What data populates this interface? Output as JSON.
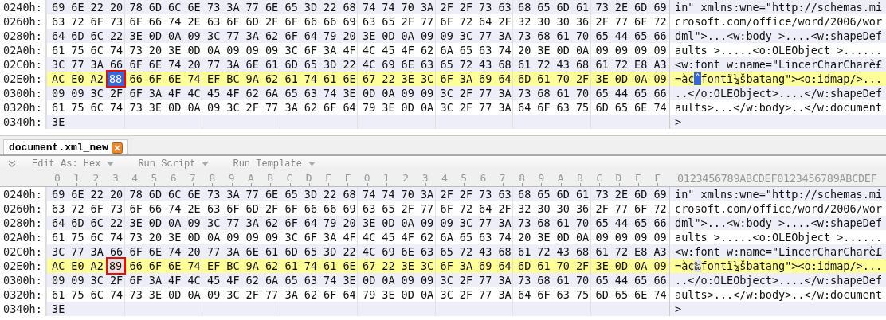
{
  "panes": [
    {
      "rows": [
        {
          "address": "0240h:",
          "hex": "69 6E 22 20 78 6D 6C 6E 73 3A 77 6E 65 3D 22 68 74 74 70 3A 2F 2F 73 63 68 65 6D 61 73 2E 6D 69",
          "text": "in\" xmlns:wne=\"http://schemas.mi",
          "highlighted": false
        },
        {
          "address": "0260h:",
          "hex": "63 72 6F 73 6F 66 74 2E 63 6F 6D 2F 6F 66 66 69 63 65 2F 77 6F 72 64 2F 32 30 30 36 2F 77 6F 72",
          "text": "crosoft.com/office/word/2006/wor",
          "highlighted": false
        },
        {
          "address": "0280h:",
          "hex": "64 6D 6C 22 3E 0D 0A 09 3C 77 3A 62 6F 64 79 20 3E 0D 0A 09 09 3C 77 3A 73 68 61 70 65 44 65 66",
          "text": "dml\">...<w:body >....<w:shapeDef",
          "highlighted": false
        },
        {
          "address": "02A0h:",
          "hex": "61 75 6C 74 73 20 3E 0D 0A 09 09 09 3C 6F 3A 4F 4C 45 4F 62 6A 65 63 74 20 3E 0D 0A 09 09 09 09",
          "text": "aults >.....<o:OLEObject >......",
          "highlighted": false
        },
        {
          "address": "02C0h:",
          "hex": "3C 77 3A 66 6F 6E 74 20 77 3A 6E 61 6D 65 3D 22 4C 69 6E 63 65 72 43 68 61 72 43 68 61 72 E8 A3",
          "text": "<w:font w:name=\"LincerCharCharè£",
          "highlighted": false
        },
        {
          "address": "02E0h:",
          "hex": "AC E0 A2",
          "cursor": {
            "hex": "88",
            "char": "ˆ",
            "selected": true,
            "annotated": true
          },
          "hex_after": "66 6F 6E 74 EF BC 9A 62 61 74 61 6E 67 22 3E 3C 6F 3A 69 64 6D 61 70 2F 3E 0D 0A 09",
          "text": "¬à¢",
          "text_after": "fontï¼šbatang\"><o:idmap/>...",
          "highlighted": true
        },
        {
          "address": "0300h:",
          "hex": "09 09 3C 2F 6F 3A 4F 4C 45 4F 62 6A 65 63 74 3E 0D 0A 09 09 3C 2F 77 3A 73 68 61 70 65 44 65 66",
          "text": "..</o:OLEObject>....</w:shapeDef",
          "highlighted": false
        },
        {
          "address": "0320h:",
          "hex": "61 75 6C 74 73 3E 0D 0A 09 3C 2F 77 3A 62 6F 64 79 3E 0D 0A 3C 2F 77 3A 64 6F 63 75 6D 65 6E 74",
          "text": "aults>...</w:body>..</w:document",
          "highlighted": false
        },
        {
          "address": "0340h:",
          "hex": "3E",
          "text": ">",
          "highlighted": false
        }
      ]
    },
    {
      "tab": {
        "label": "document.xml_new",
        "selected": true
      },
      "toolbar": [
        {
          "label": "Edit As: Hex"
        },
        {
          "label": "Run Script"
        },
        {
          "label": "Run Template"
        }
      ],
      "column_header": {
        "hex_digits": "0 1 2 3 4 5 6 7 8 9 A B C D E F 0 1 2 3 4 5 6 7 8 9 A B C D E F",
        "text_digits": "0123456789ABCDEF0123456789ABCDEF"
      },
      "rows": [
        {
          "address": "0240h:",
          "hex": "69 6E 22 20 78 6D 6C 6E 73 3A 77 6E 65 3D 22 68 74 74 70 3A 2F 2F 73 63 68 65 6D 61 73 2E 6D 69",
          "text": "in\" xmlns:wne=\"http://schemas.mi",
          "highlighted": false
        },
        {
          "address": "0260h:",
          "hex": "63 72 6F 73 6F 66 74 2E 63 6F 6D 2F 6F 66 66 69 63 65 2F 77 6F 72 64 2F 32 30 30 36 2F 77 6F 72",
          "text": "crosoft.com/office/word/2006/wor",
          "highlighted": false
        },
        {
          "address": "0280h:",
          "hex": "64 6D 6C 22 3E 0D 0A 09 3C 77 3A 62 6F 64 79 20 3E 0D 0A 09 09 3C 77 3A 73 68 61 70 65 44 65 66",
          "text": "dml\">...<w:body >....<w:shapeDef",
          "highlighted": false
        },
        {
          "address": "02A0h:",
          "hex": "61 75 6C 74 73 20 3E 0D 0A 09 09 09 3C 6F 3A 4F 4C 45 4F 62 6A 65 63 74 20 3E 0D 0A 09 09 09 09",
          "text": "aults >.....<o:OLEObject >......",
          "highlighted": false
        },
        {
          "address": "02C0h:",
          "hex": "3C 77 3A 66 6F 6E 74 20 77 3A 6E 61 6D 65 3D 22 4C 69 6E 63 65 72 43 68 61 72 43 68 61 72 E8 A3",
          "text": "<w:font w:name=\"LincerCharCharè£",
          "highlighted": false
        },
        {
          "address": "02E0h:",
          "hex": "AC E0 A2",
          "cursor": {
            "hex": "89",
            "char": "‰",
            "selected": false,
            "annotated": true
          },
          "hex_after": "66 6F 6E 74 EF BC 9A 62 61 74 61 6E 67 22 3E 3C 6F 3A 69 64 6D 61 70 2F 3E 0D 0A 09",
          "text": "¬à¢",
          "text_after": "fontï¼šbatang\"><o:idmap/>...",
          "highlighted": true
        },
        {
          "address": "0300h:",
          "hex": "09 09 3C 2F 6F 3A 4F 4C 45 4F 62 6A 65 63 74 3E 0D 0A 09 09 3C 2F 77 3A 73 68 61 70 65 44 65 66",
          "text": "..</o:OLEObject>....</w:shapeDef",
          "highlighted": false
        },
        {
          "address": "0320h:",
          "hex": "61 75 6C 74 73 3E 0D 0A 09 3C 2F 77 3A 62 6F 64 79 3E 0D 0A 3C 2F 77 3A 64 6F 63 75 6D 65 6E 74",
          "text": "aults>...</w:body>..</w:document",
          "highlighted": false
        },
        {
          "address": "0340h:",
          "hex": "3E",
          "text": ">",
          "highlighted": false
        }
      ]
    }
  ]
}
